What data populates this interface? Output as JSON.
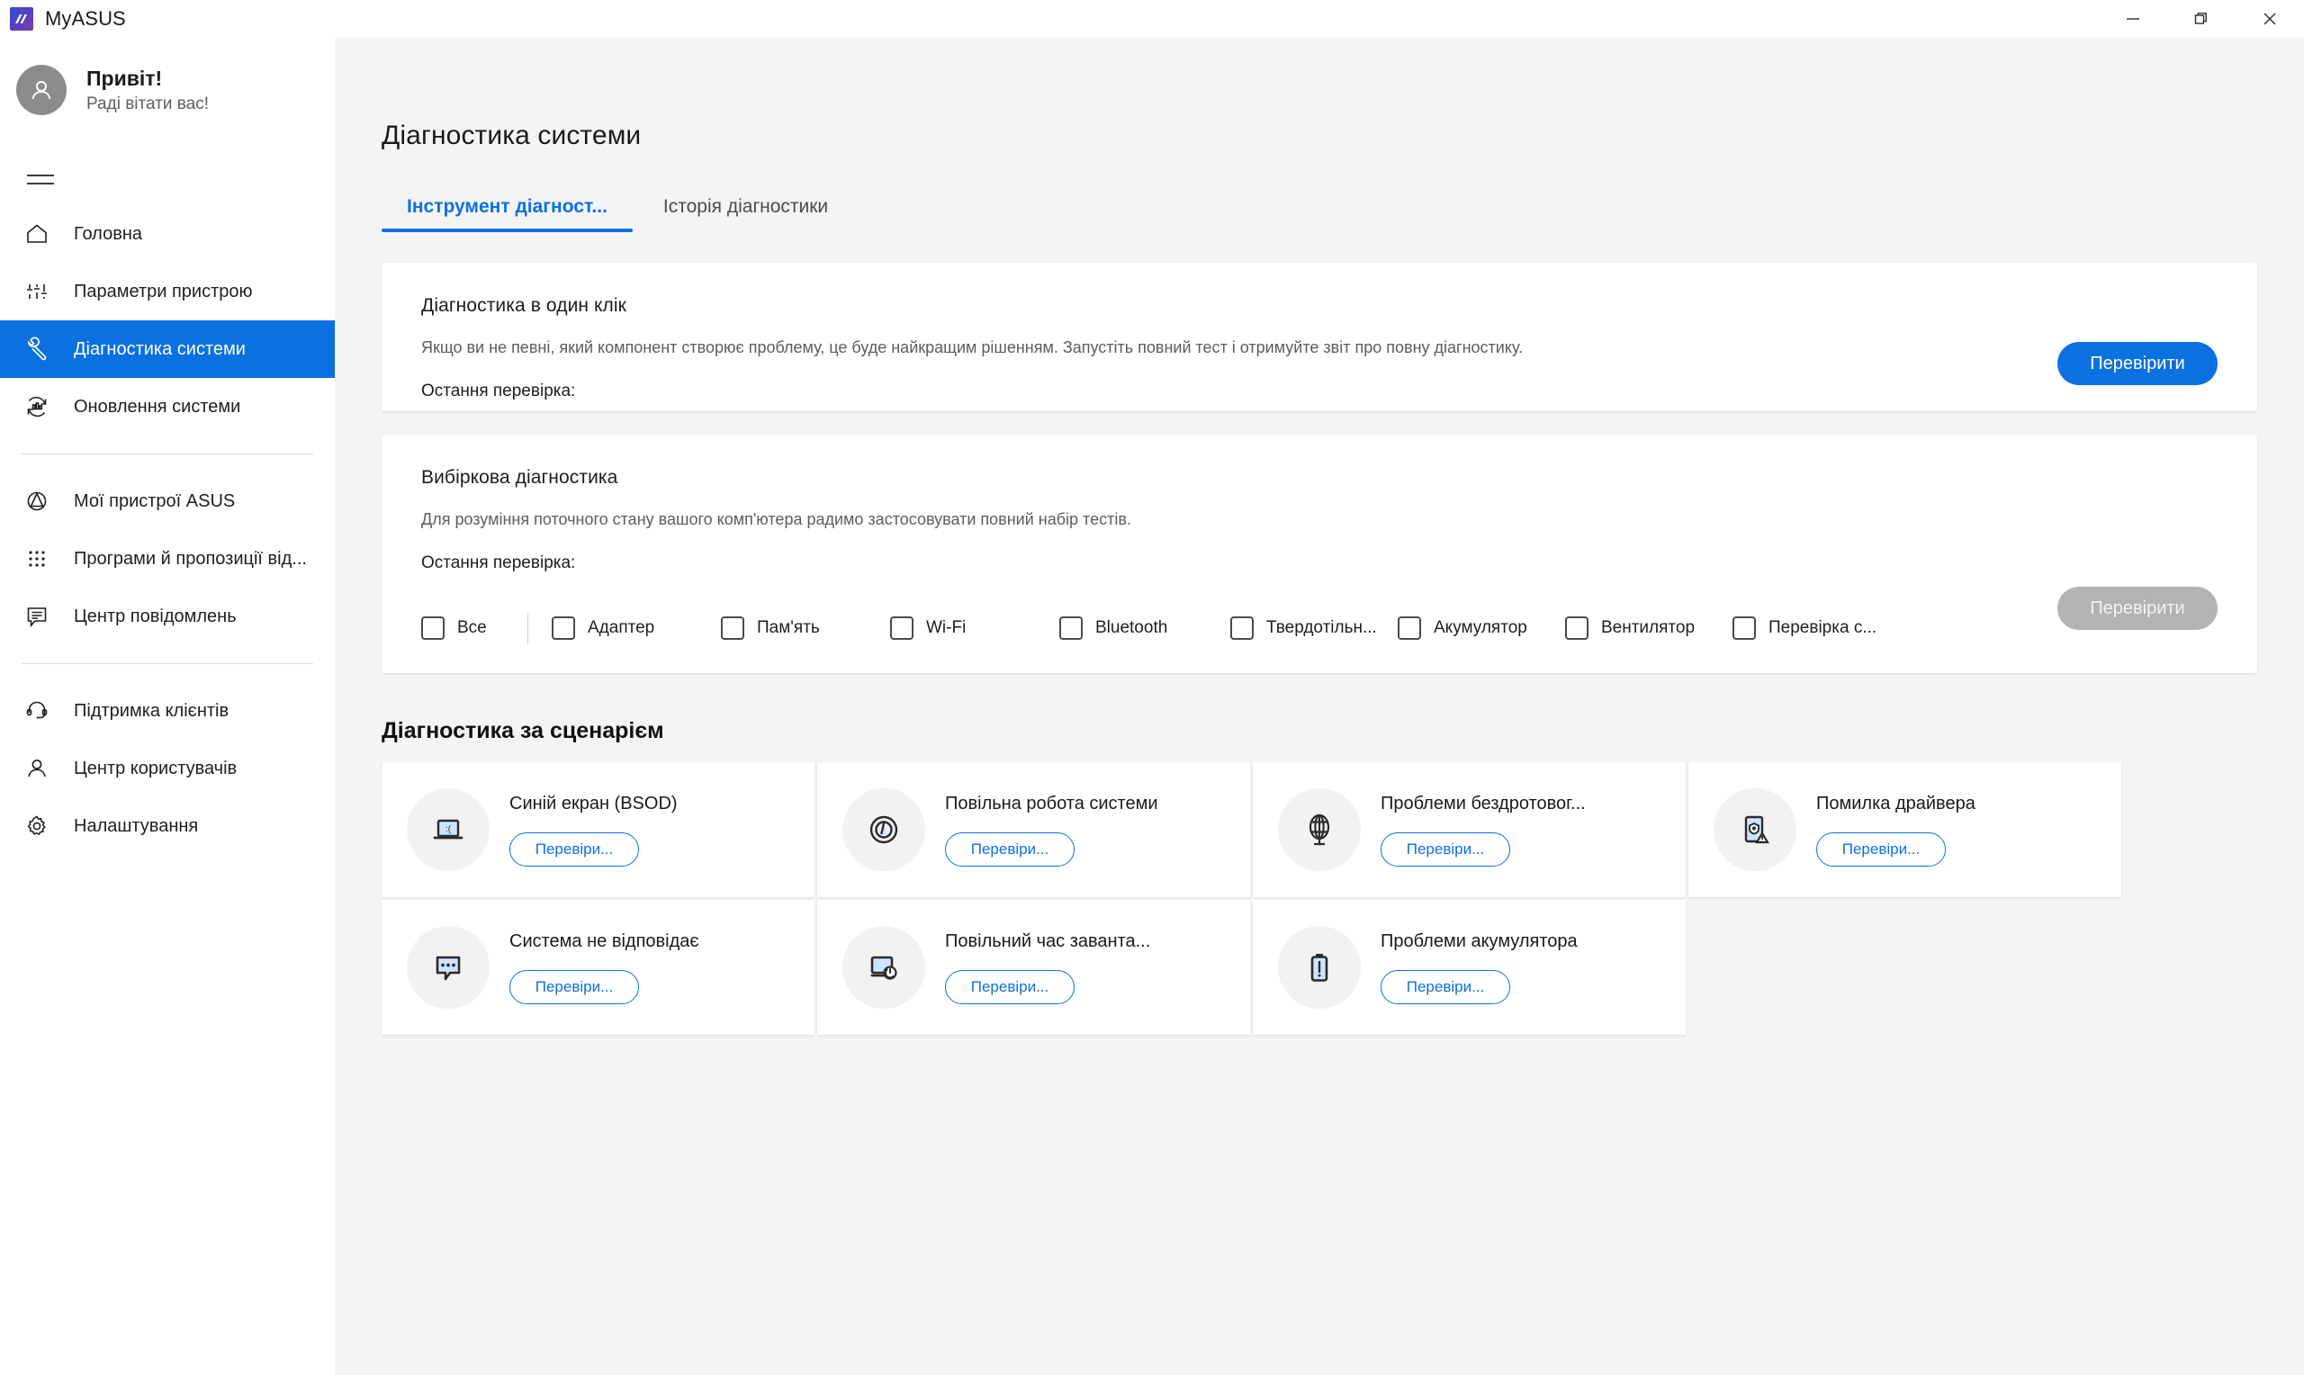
{
  "window": {
    "app_title": "MyASUS",
    "logo_icon": "asus-logo-icon",
    "controls": {
      "minimize": "minimize-icon",
      "maximize": "restore-icon",
      "close": "close-icon"
    }
  },
  "sidebar": {
    "profile": {
      "greeting": "Привіт!",
      "subtitle": "Раді вітати вас!",
      "avatar_icon": "person-avatar-icon"
    },
    "menu_icon": "hamburger-menu-icon",
    "groups": [
      {
        "items": [
          {
            "label": "Головна",
            "icon": "home-icon",
            "active": false
          },
          {
            "label": "Параметри пристрою",
            "icon": "sliders-icon",
            "active": false
          },
          {
            "label": "Діагностика системи",
            "icon": "wrench-icon",
            "active": true
          },
          {
            "label": "Оновлення системи",
            "icon": "update-refresh-icon",
            "active": false
          }
        ]
      },
      {
        "items": [
          {
            "label": "Мої пристрої ASUS",
            "icon": "asus-devices-icon",
            "active": false
          },
          {
            "label": "Програми й пропозиції від...",
            "icon": "apps-grid-icon",
            "active": false
          },
          {
            "label": "Центр повідомлень",
            "icon": "message-icon",
            "active": false
          }
        ]
      },
      {
        "items": [
          {
            "label": "Підтримка клієнтів",
            "icon": "headset-icon",
            "active": false
          },
          {
            "label": "Центр користувачів",
            "icon": "user-icon",
            "active": false
          },
          {
            "label": "Налаштування",
            "icon": "gear-icon",
            "active": false
          }
        ]
      }
    ]
  },
  "main": {
    "page_title": "Діагностика системи",
    "tabs": [
      {
        "label": "Інструмент діагност...",
        "active": true
      },
      {
        "label": "Історія діагностики",
        "active": false
      }
    ],
    "one_click": {
      "heading": "Діагностика в один клік",
      "description": "Якщо ви не певні, який компонент створює проблему, це буде найкращим рішенням. Запустіть повний тест і отримуйте звіт про повну діагностику.",
      "last_check_label": "Остання перевірка:",
      "last_check_value": "",
      "button": "Перевірити"
    },
    "selective": {
      "heading": "Вибіркова діагностика",
      "description": "Для розуміння поточного стану вашого комп'ютера радимо застосовувати повний набір тестів.",
      "last_check_label": "Остання перевірка:",
      "last_check_value": "",
      "button": "Перевірити",
      "button_disabled": true,
      "checkboxes": [
        {
          "label": "Все",
          "checked": false
        },
        {
          "label": "Адаптер",
          "checked": false
        },
        {
          "label": "Пам'ять",
          "checked": false
        },
        {
          "label": "Wi-Fi",
          "checked": false
        },
        {
          "label": "Bluetooth",
          "checked": false
        },
        {
          "label": "Твердотільн...",
          "checked": false
        },
        {
          "label": "Акумулятор",
          "checked": false
        },
        {
          "label": "Вентилятор",
          "checked": false
        },
        {
          "label": "Перевірка с...",
          "checked": false
        }
      ]
    },
    "scenario": {
      "title": "Діагностика за сценарієм",
      "cards": [
        {
          "name": "Синій екран (BSOD)",
          "icon": "laptop-sad-face-icon",
          "button": "Перевіри..."
        },
        {
          "name": "Повільна робота системи",
          "icon": "speedometer-icon",
          "button": "Перевіри..."
        },
        {
          "name": "Проблеми бездротовог...",
          "icon": "globe-icon",
          "button": "Перевіри..."
        },
        {
          "name": "Помилка драйвера",
          "icon": "device-shield-warning-icon",
          "button": "Перевіри..."
        },
        {
          "name": "Система не відповідає",
          "icon": "speech-bubble-dots-icon",
          "button": "Перевіри..."
        },
        {
          "name": "Повільний час заванта...",
          "icon": "monitor-power-icon",
          "button": "Перевіри..."
        },
        {
          "name": "Проблеми акумулятора",
          "icon": "battery-warning-icon",
          "button": "Перевіри..."
        }
      ]
    }
  },
  "colors": {
    "accent": "#0c71e0",
    "content_bg": "#f4f4f4",
    "card_bg": "#ffffff",
    "disabled": "#b3b3b3",
    "icon_fill_light": "#cfe3fb"
  }
}
